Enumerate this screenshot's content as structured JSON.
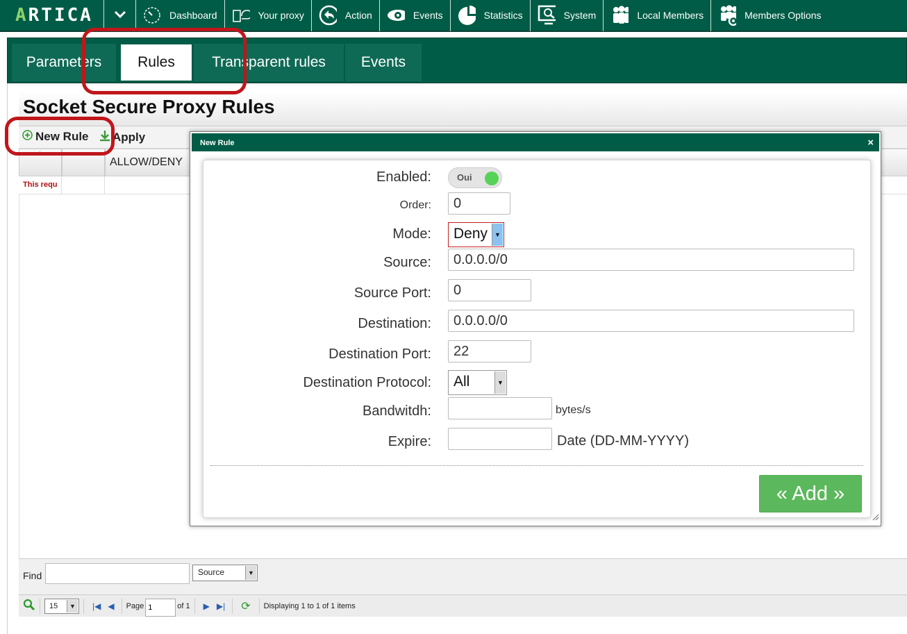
{
  "app": {
    "logo": "ARTICA",
    "logo_accent": "A"
  },
  "nav": {
    "items": [
      {
        "label": "Dashboard",
        "icon": "dashboard-icon"
      },
      {
        "label": "Your proxy",
        "icon": "proxy-icon"
      },
      {
        "label": "Action",
        "icon": "action-icon"
      },
      {
        "label": "Events",
        "icon": "eye-icon"
      },
      {
        "label": "Statistics",
        "icon": "pie-chart-icon"
      },
      {
        "label": "System",
        "icon": "system-icon"
      },
      {
        "label": "Local Members",
        "icon": "members-icon"
      },
      {
        "label": "Members Options",
        "icon": "members-options-icon"
      }
    ]
  },
  "tabs": [
    {
      "label": "Parameters"
    },
    {
      "label": "Rules"
    },
    {
      "label": "Transparent rules"
    },
    {
      "label": "Events"
    }
  ],
  "page": {
    "title": "Socket Secure Proxy Rules",
    "toolbar": {
      "new_rule": "New Rule",
      "apply": "Apply"
    }
  },
  "grid": {
    "column_allow_deny": "ALLOW/DENY",
    "row_text": "This requ"
  },
  "modal": {
    "title": "New Rule",
    "close": "×",
    "enabled_label": "Enabled:",
    "enabled_value": "Oui",
    "order_label": "Order:",
    "order_value": "0",
    "mode_label": "Mode:",
    "mode_value": "Deny",
    "source_label": "Source:",
    "source_value": "0.0.0.0/0",
    "source_port_label": "Source Port:",
    "source_port_value": "0",
    "destination_label": "Destination:",
    "destination_value": "0.0.0.0/0",
    "destination_port_label": "Destination Port:",
    "destination_port_value": "22",
    "destination_protocol_label": "Destination Protocol:",
    "destination_protocol_value": "All",
    "bandwidth_label": "Bandwitdh:",
    "bandwidth_value": "",
    "bandwidth_unit": "bytes/s",
    "expire_label": "Expire:",
    "expire_value": "",
    "expire_hint": "Date (DD-MM-YYYY)",
    "add_button": "« Add »"
  },
  "find": {
    "label": "Find",
    "value": "",
    "field": "Source"
  },
  "pager": {
    "per_page": "15",
    "page_label": "Page",
    "page_value": "1",
    "of_label": "of 1",
    "status": "Displaying 1 to 1 of 1 items"
  },
  "colors": {
    "brand": "#005c46",
    "accent": "#8fd36b",
    "add": "#5cb85c",
    "highlight": "#c0161b"
  }
}
